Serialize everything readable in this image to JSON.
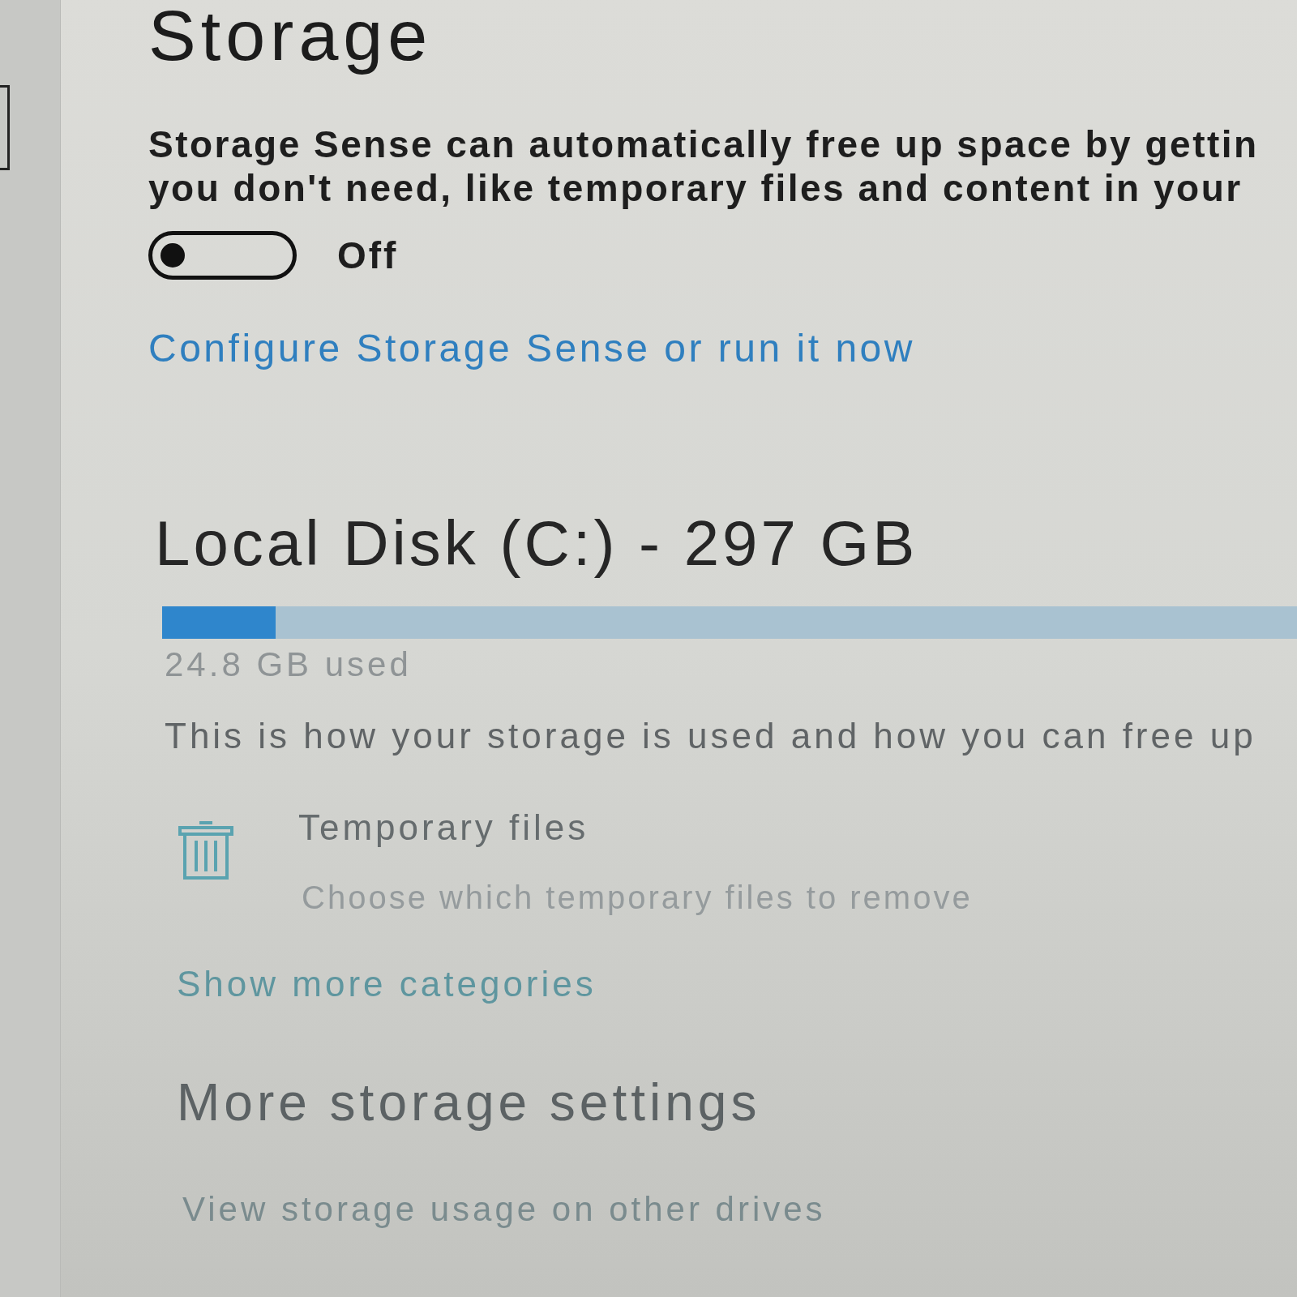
{
  "page": {
    "title": "Storage"
  },
  "storage_sense": {
    "description_lines": [
      "Storage Sense can automatically free up space by gettin",
      "you don't need, like temporary files and content in your"
    ],
    "on": false,
    "state_label": "Off",
    "link": "Configure Storage Sense or run it now"
  },
  "drive": {
    "name": "Local Disk (C:) - 297 GB",
    "level": 0.1,
    "used": "24.8 GB used",
    "description": "This is how your storage is used and how you can free up"
  },
  "categories": [
    {
      "kind": "trash",
      "name": "Temporary files",
      "detail": "Choose which temporary files to remove"
    }
  ],
  "show_more": "Show more categories",
  "more_settings": {
    "heading": "More storage settings",
    "links": [
      "View storage usage on other drives"
    ]
  }
}
